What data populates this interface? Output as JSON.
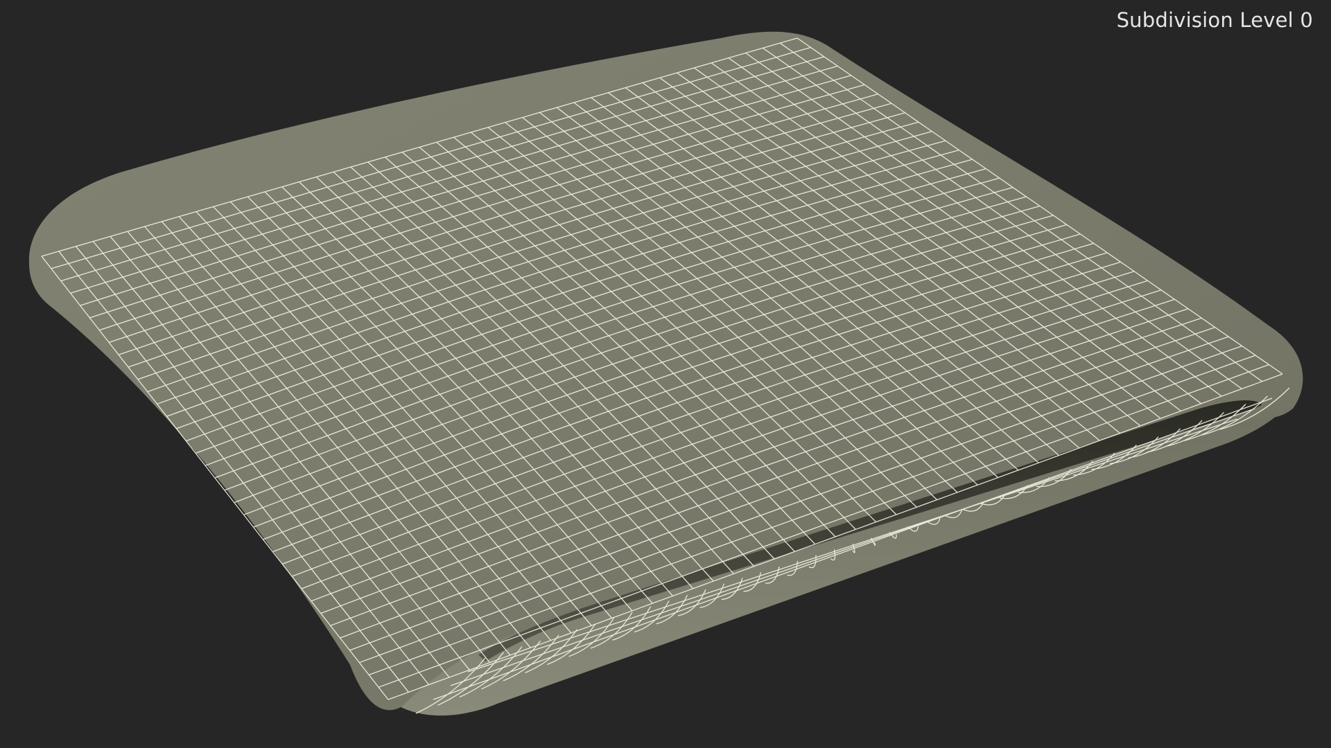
{
  "viewport": {
    "overlay_label": "Subdivision Level 0",
    "background_color": "#262626"
  },
  "model": {
    "object": "cushion",
    "display_mode": "wireframe-on-shaded",
    "surface_color": "#7a7a6b",
    "wire_color": "#f4f2e4"
  }
}
